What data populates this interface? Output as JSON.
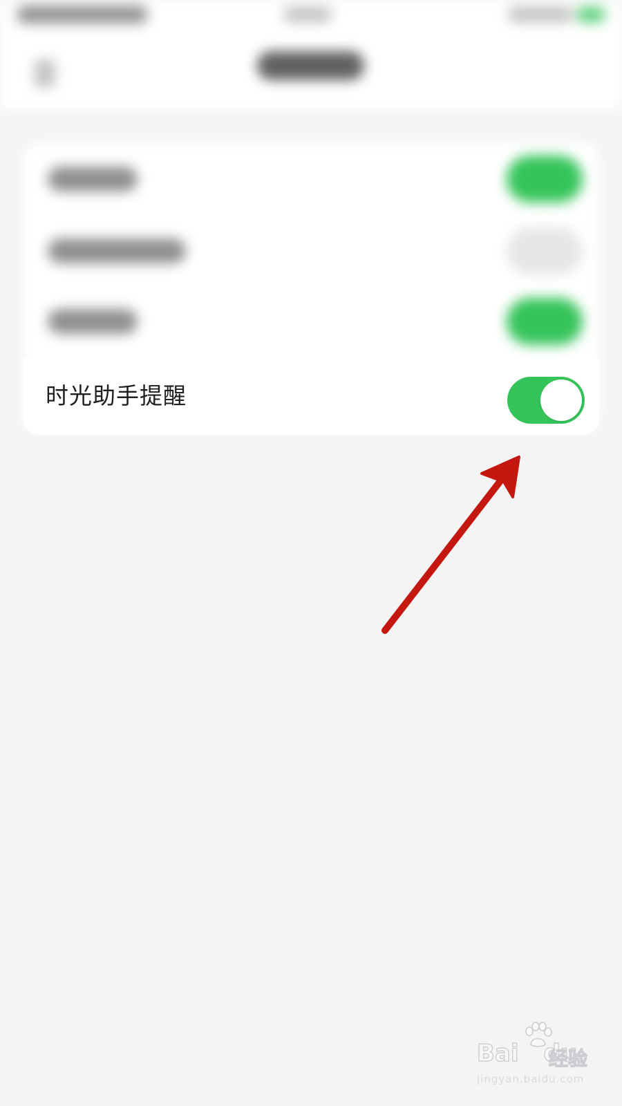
{
  "settings": {
    "focused_row": {
      "label": "时光助手提醒",
      "toggle_on": true
    },
    "colors": {
      "toggle_on": "#35c45a",
      "arrow": "#c4170f",
      "background": "#f4f4f4"
    }
  },
  "watermark": {
    "brand": "Bai",
    "brand_suffix": "du",
    "product": "经验",
    "url": "jingyan.baidu.com"
  }
}
